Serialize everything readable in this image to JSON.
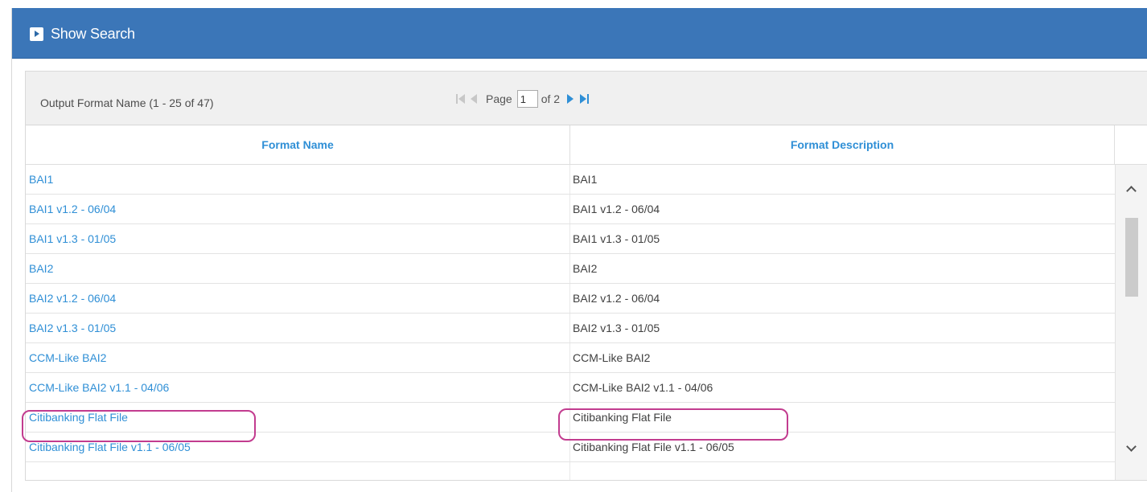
{
  "search_bar": {
    "toggle_label": "Show Search",
    "background_color": "#3b76b8",
    "icon": "expand-arrow-icon"
  },
  "grid": {
    "caption": "Output Format Name (1 - 25 of 47)",
    "pager": {
      "page_label": "Page",
      "current_page": "1",
      "of_label": "of 2",
      "first_icon": "first-page-icon",
      "prev_icon": "previous-page-icon",
      "next_icon": "next-page-icon",
      "last_icon": "last-page-icon"
    },
    "columns": [
      "Format Name",
      "Format Description"
    ],
    "rows": [
      {
        "name": "BAI1",
        "description": "BAI1"
      },
      {
        "name": "BAI1 v1.2 - 06/04",
        "description": "BAI1 v1.2 - 06/04"
      },
      {
        "name": "BAI1 v1.3 - 01/05",
        "description": "BAI1 v1.3 - 01/05"
      },
      {
        "name": "BAI2",
        "description": "BAI2"
      },
      {
        "name": "BAI2 v1.2 - 06/04",
        "description": "BAI2 v1.2 - 06/04"
      },
      {
        "name": "BAI2 v1.3 - 01/05",
        "description": "BAI2 v1.3 - 01/05"
      },
      {
        "name": "CCM-Like BAI2",
        "description": "CCM-Like BAI2"
      },
      {
        "name": "CCM-Like BAI2 v1.1 - 04/06",
        "description": "CCM-Like BAI2 v1.1 - 04/06"
      },
      {
        "name": "Citibanking Flat File",
        "description": "Citibanking Flat File"
      },
      {
        "name": "Citibanking Flat File v1.1 - 06/05",
        "description": "Citibanking Flat File v1.1 - 06/05"
      }
    ],
    "link_color": "#2f8fd6",
    "highlight_color": "#c23c8f"
  }
}
